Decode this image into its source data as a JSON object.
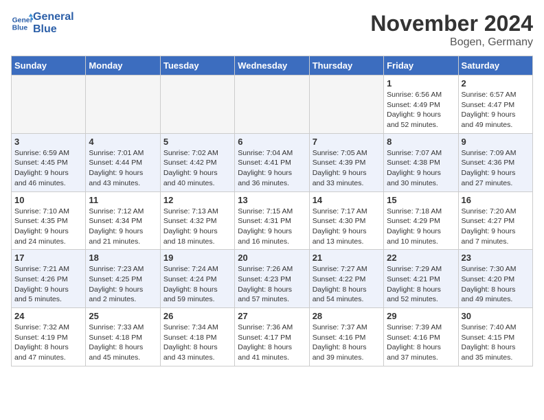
{
  "header": {
    "logo_line1": "General",
    "logo_line2": "Blue",
    "month": "November 2024",
    "location": "Bogen, Germany"
  },
  "days_of_week": [
    "Sunday",
    "Monday",
    "Tuesday",
    "Wednesday",
    "Thursday",
    "Friday",
    "Saturday"
  ],
  "weeks": [
    {
      "alt": false,
      "days": [
        {
          "n": "",
          "info": "",
          "empty": true
        },
        {
          "n": "",
          "info": "",
          "empty": true
        },
        {
          "n": "",
          "info": "",
          "empty": true
        },
        {
          "n": "",
          "info": "",
          "empty": true
        },
        {
          "n": "",
          "info": "",
          "empty": true
        },
        {
          "n": "1",
          "info": "Sunrise: 6:56 AM\nSunset: 4:49 PM\nDaylight: 9 hours\nand 52 minutes.",
          "empty": false
        },
        {
          "n": "2",
          "info": "Sunrise: 6:57 AM\nSunset: 4:47 PM\nDaylight: 9 hours\nand 49 minutes.",
          "empty": false
        }
      ]
    },
    {
      "alt": true,
      "days": [
        {
          "n": "3",
          "info": "Sunrise: 6:59 AM\nSunset: 4:45 PM\nDaylight: 9 hours\nand 46 minutes.",
          "empty": false
        },
        {
          "n": "4",
          "info": "Sunrise: 7:01 AM\nSunset: 4:44 PM\nDaylight: 9 hours\nand 43 minutes.",
          "empty": false
        },
        {
          "n": "5",
          "info": "Sunrise: 7:02 AM\nSunset: 4:42 PM\nDaylight: 9 hours\nand 40 minutes.",
          "empty": false
        },
        {
          "n": "6",
          "info": "Sunrise: 7:04 AM\nSunset: 4:41 PM\nDaylight: 9 hours\nand 36 minutes.",
          "empty": false
        },
        {
          "n": "7",
          "info": "Sunrise: 7:05 AM\nSunset: 4:39 PM\nDaylight: 9 hours\nand 33 minutes.",
          "empty": false
        },
        {
          "n": "8",
          "info": "Sunrise: 7:07 AM\nSunset: 4:38 PM\nDaylight: 9 hours\nand 30 minutes.",
          "empty": false
        },
        {
          "n": "9",
          "info": "Sunrise: 7:09 AM\nSunset: 4:36 PM\nDaylight: 9 hours\nand 27 minutes.",
          "empty": false
        }
      ]
    },
    {
      "alt": false,
      "days": [
        {
          "n": "10",
          "info": "Sunrise: 7:10 AM\nSunset: 4:35 PM\nDaylight: 9 hours\nand 24 minutes.",
          "empty": false
        },
        {
          "n": "11",
          "info": "Sunrise: 7:12 AM\nSunset: 4:34 PM\nDaylight: 9 hours\nand 21 minutes.",
          "empty": false
        },
        {
          "n": "12",
          "info": "Sunrise: 7:13 AM\nSunset: 4:32 PM\nDaylight: 9 hours\nand 18 minutes.",
          "empty": false
        },
        {
          "n": "13",
          "info": "Sunrise: 7:15 AM\nSunset: 4:31 PM\nDaylight: 9 hours\nand 16 minutes.",
          "empty": false
        },
        {
          "n": "14",
          "info": "Sunrise: 7:17 AM\nSunset: 4:30 PM\nDaylight: 9 hours\nand 13 minutes.",
          "empty": false
        },
        {
          "n": "15",
          "info": "Sunrise: 7:18 AM\nSunset: 4:29 PM\nDaylight: 9 hours\nand 10 minutes.",
          "empty": false
        },
        {
          "n": "16",
          "info": "Sunrise: 7:20 AM\nSunset: 4:27 PM\nDaylight: 9 hours\nand 7 minutes.",
          "empty": false
        }
      ]
    },
    {
      "alt": true,
      "days": [
        {
          "n": "17",
          "info": "Sunrise: 7:21 AM\nSunset: 4:26 PM\nDaylight: 9 hours\nand 5 minutes.",
          "empty": false
        },
        {
          "n": "18",
          "info": "Sunrise: 7:23 AM\nSunset: 4:25 PM\nDaylight: 9 hours\nand 2 minutes.",
          "empty": false
        },
        {
          "n": "19",
          "info": "Sunrise: 7:24 AM\nSunset: 4:24 PM\nDaylight: 8 hours\nand 59 minutes.",
          "empty": false
        },
        {
          "n": "20",
          "info": "Sunrise: 7:26 AM\nSunset: 4:23 PM\nDaylight: 8 hours\nand 57 minutes.",
          "empty": false
        },
        {
          "n": "21",
          "info": "Sunrise: 7:27 AM\nSunset: 4:22 PM\nDaylight: 8 hours\nand 54 minutes.",
          "empty": false
        },
        {
          "n": "22",
          "info": "Sunrise: 7:29 AM\nSunset: 4:21 PM\nDaylight: 8 hours\nand 52 minutes.",
          "empty": false
        },
        {
          "n": "23",
          "info": "Sunrise: 7:30 AM\nSunset: 4:20 PM\nDaylight: 8 hours\nand 49 minutes.",
          "empty": false
        }
      ]
    },
    {
      "alt": false,
      "days": [
        {
          "n": "24",
          "info": "Sunrise: 7:32 AM\nSunset: 4:19 PM\nDaylight: 8 hours\nand 47 minutes.",
          "empty": false
        },
        {
          "n": "25",
          "info": "Sunrise: 7:33 AM\nSunset: 4:18 PM\nDaylight: 8 hours\nand 45 minutes.",
          "empty": false
        },
        {
          "n": "26",
          "info": "Sunrise: 7:34 AM\nSunset: 4:18 PM\nDaylight: 8 hours\nand 43 minutes.",
          "empty": false
        },
        {
          "n": "27",
          "info": "Sunrise: 7:36 AM\nSunset: 4:17 PM\nDaylight: 8 hours\nand 41 minutes.",
          "empty": false
        },
        {
          "n": "28",
          "info": "Sunrise: 7:37 AM\nSunset: 4:16 PM\nDaylight: 8 hours\nand 39 minutes.",
          "empty": false
        },
        {
          "n": "29",
          "info": "Sunrise: 7:39 AM\nSunset: 4:16 PM\nDaylight: 8 hours\nand 37 minutes.",
          "empty": false
        },
        {
          "n": "30",
          "info": "Sunrise: 7:40 AM\nSunset: 4:15 PM\nDaylight: 8 hours\nand 35 minutes.",
          "empty": false
        }
      ]
    }
  ]
}
